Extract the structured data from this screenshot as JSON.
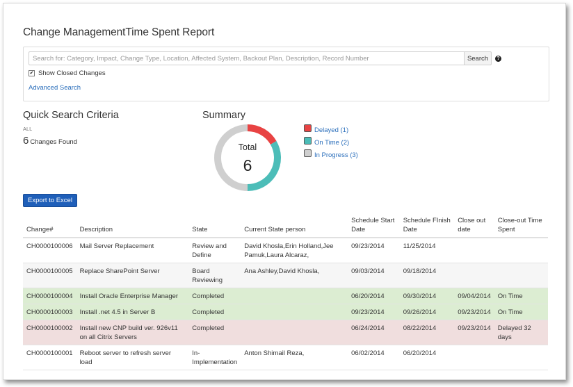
{
  "page": {
    "title": "Change ManagementTime Spent Report"
  },
  "search": {
    "placeholder": "Search for: Category, Impact, Change Type, Location, Affected System, Backout Plan, Description, Record Number",
    "button_label": "Search",
    "show_closed_label": "Show Closed Changes",
    "show_closed_checked": true,
    "advanced_link": "Advanced Search"
  },
  "quick_search": {
    "title": "Quick Search Criteria",
    "filter": "ALL",
    "count": "6",
    "count_label": "Changes Found"
  },
  "summary": {
    "title": "Summary",
    "total_label": "Total",
    "total_value": "6",
    "legend": [
      {
        "label": "Delayed (1)",
        "value": 1,
        "color": "#e84343"
      },
      {
        "label": "On Time (2)",
        "value": 2,
        "color": "#4cbdb8"
      },
      {
        "label": "In Progress (3)",
        "value": 3,
        "color": "#cfcfcf"
      }
    ]
  },
  "export": {
    "label": "Export to Excel"
  },
  "table": {
    "headers": {
      "change_no": "Change#",
      "description": "Description",
      "state": "State",
      "person": "Current State person",
      "sched_start": "Schedule Start Date",
      "sched_finish": "Schedule FInish Date",
      "close_out": "Close out date",
      "time_spent": "Close-out Time Spent"
    },
    "rows": [
      {
        "status": "progress",
        "change_no": "CH0000100006",
        "description": "Mail Server Replacement",
        "state": "Review and Define",
        "person": "David Khosla,Erin Holland,Jee Pamuk,Laura Alcaraz,",
        "sched_start": "09/23/2014",
        "sched_finish": "11/25/2014",
        "close_out": "",
        "time_spent": ""
      },
      {
        "status": "progress",
        "change_no": "CH0000100005",
        "description": "Replace SharePoint Server",
        "state": "Board Reviewing",
        "person": "Ana Ashley,David Khosla,",
        "sched_start": "09/03/2014",
        "sched_finish": "09/18/2014",
        "close_out": "",
        "time_spent": ""
      },
      {
        "status": "ontime",
        "change_no": "CH0000100004",
        "description": "Install Oracle Enterprise Manager",
        "state": "Completed",
        "person": "",
        "sched_start": "06/20/2014",
        "sched_finish": "09/30/2014",
        "close_out": "09/04/2014",
        "time_spent": "On Time"
      },
      {
        "status": "ontime",
        "change_no": "CH0000100003",
        "description": "Install .net 4.5 in Server B",
        "state": "Completed",
        "person": "",
        "sched_start": "09/23/2014",
        "sched_finish": "09/26/2014",
        "close_out": "09/23/2014",
        "time_spent": "On Time"
      },
      {
        "status": "delayed",
        "change_no": "CH0000100002",
        "description": "Install new CNP build ver. 926v11 on all Citrix Servers",
        "state": "Completed",
        "person": "",
        "sched_start": "06/24/2014",
        "sched_finish": "08/22/2014",
        "close_out": "09/23/2014",
        "time_spent": "Delayed 32 days"
      },
      {
        "status": "progress",
        "change_no": "CH0000100001",
        "description": "Reboot server to refresh server load",
        "state": "In-Implementation",
        "person": "Anton Shimail Reza,",
        "sched_start": "06/02/2014",
        "sched_finish": "06/20/2014",
        "close_out": "",
        "time_spent": ""
      }
    ]
  }
}
